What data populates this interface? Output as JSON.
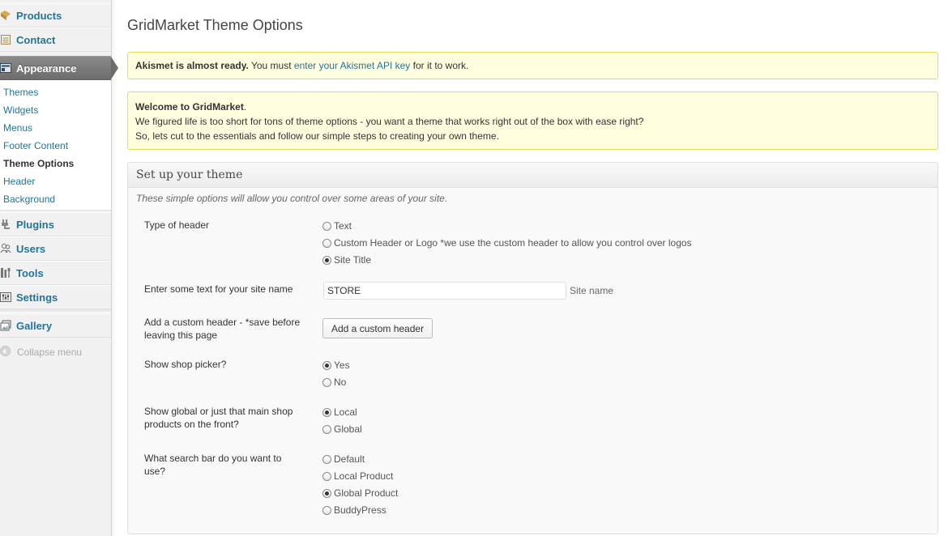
{
  "sidebar": {
    "top_items": [
      {
        "label": "Products",
        "icon": "products-icon"
      },
      {
        "label": "Contact",
        "icon": "contact-icon"
      }
    ],
    "active": {
      "label": "Appearance",
      "icon": "appearance-icon"
    },
    "submenu": [
      "Themes",
      "Widgets",
      "Menus",
      "Footer Content",
      "Theme Options",
      "Header",
      "Background"
    ],
    "submenu_current": "Theme Options",
    "bottom_items": [
      {
        "label": "Plugins",
        "icon": "plugins-icon"
      },
      {
        "label": "Users",
        "icon": "users-icon"
      },
      {
        "label": "Tools",
        "icon": "tools-icon"
      },
      {
        "label": "Settings",
        "icon": "settings-icon"
      },
      {
        "label": "Gallery",
        "icon": "gallery-icon"
      }
    ],
    "collapse_label": "Collapse menu"
  },
  "page": {
    "title": "GridMarket Theme Options"
  },
  "notices": {
    "akismet": {
      "strong": "Akismet is almost ready.",
      "pre": "You must",
      "link": "enter your Akismet API key",
      "post": "for it to work."
    },
    "welcome": {
      "strong": "Welcome to GridMarket",
      "dot": ".",
      "line1": "We figured life is too short for tons of theme options - you want a theme that works right out of the box with ease right?",
      "line2": "So, lets cut to the essentials and follow our simple steps to creating your own theme."
    }
  },
  "setup": {
    "title": "Set up your theme",
    "description": "These simple options will allow you control over some areas of your site.",
    "header_type": {
      "label": "Type of header",
      "options": [
        "Text",
        "Custom Header or Logo *we use the custom header to allow you control over logos",
        "Site Title"
      ],
      "selected": "Site Title"
    },
    "site_name": {
      "label": "Enter some text for your site name",
      "value": "STORE",
      "description": "Site name"
    },
    "custom_header": {
      "label": "Add a custom header - *save before leaving this page",
      "button": "Add a custom header"
    },
    "shop_picker": {
      "label": "Show shop picker?",
      "options": [
        "Yes",
        "No"
      ],
      "selected": "Yes"
    },
    "products_scope": {
      "label": "Show global or just that main shop products on the front?",
      "options": [
        "Local",
        "Global"
      ],
      "selected": "Local"
    },
    "search_bar": {
      "label": "What search bar do you want to use?",
      "options": [
        "Default",
        "Local Product",
        "Global Product",
        "BuddyPress"
      ],
      "selected": "Global Product"
    }
  },
  "colors": {
    "link": "#21759b",
    "notice_bg": "#ffffe0",
    "notice_border": "#e6db55"
  }
}
